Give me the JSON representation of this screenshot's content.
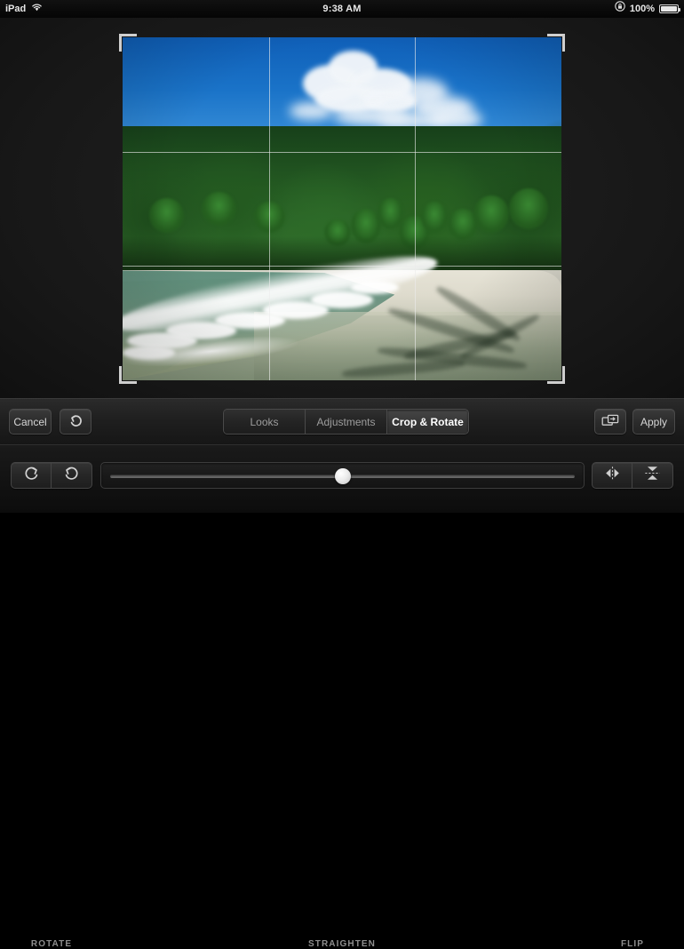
{
  "status_bar": {
    "device_label": "iPad",
    "wifi_icon": "wifi-icon",
    "time": "9:38 AM",
    "rotation_lock_icon": "rotation-lock-icon",
    "battery_percent": "100%",
    "battery_icon": "battery-icon",
    "battery_level": 100
  },
  "editor": {
    "crop_overlay": {
      "grid_type": "rule-of-thirds",
      "handles": [
        "top-left",
        "top-right",
        "bottom-left",
        "bottom-right"
      ]
    },
    "photo": {
      "alt": "Tropical beach with dense green jungle, blue sky with white clouds, turquoise ocean wave breaking on white sand"
    }
  },
  "toolbar": {
    "cancel_label": "Cancel",
    "undo_icon": "undo-icon",
    "tabs": [
      {
        "label": "Looks",
        "active": false
      },
      {
        "label": "Adjustments",
        "active": false
      },
      {
        "label": "Crop & Rotate",
        "active": true
      }
    ],
    "compare_icon": "compare-icon",
    "apply_label": "Apply"
  },
  "crop_tools": {
    "rotate": {
      "label": "ROTATE",
      "buttons": [
        {
          "icon": "rotate-clockwise-icon"
        },
        {
          "icon": "rotate-counterclockwise-icon"
        }
      ]
    },
    "straighten": {
      "label": "STRAIGHTEN",
      "value": 0,
      "min": -45,
      "max": 45,
      "thumb_percent": 50
    },
    "flip": {
      "label": "FLIP",
      "buttons": [
        {
          "icon": "flip-horizontal-icon"
        },
        {
          "icon": "flip-vertical-icon"
        }
      ]
    }
  },
  "colors": {
    "accent": "#ffffff",
    "toolbar_bg": "#1f1f1f",
    "canvas_bg": "#1c1c1c",
    "text_muted": "#9d9d9d",
    "grid_line": "#ebebeb"
  }
}
